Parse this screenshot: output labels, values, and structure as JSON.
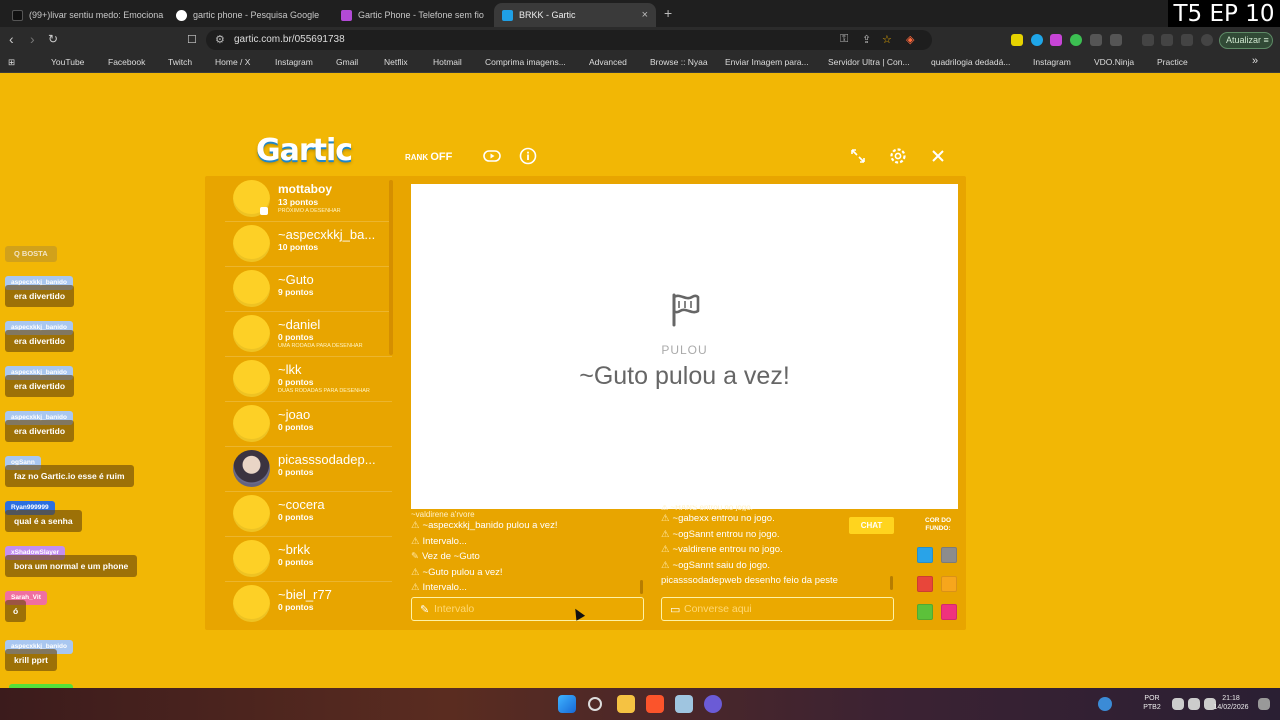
{
  "browser": {
    "tabs": [
      {
        "title": "(99+)livar sentiu medo: Emocionante"
      },
      {
        "title": "gartic phone - Pesquisa Google"
      },
      {
        "title": "Gartic Phone - Telefone sem fio"
      },
      {
        "title": "BRKK - Gartic",
        "active": true
      }
    ],
    "close_glyph": "×",
    "new_tab_glyph": "+",
    "address": "gartic.com.br/055691738",
    "update_label": "Atualizar",
    "bookmarks": [
      {
        "label": "YouTube",
        "color": "#ff0000"
      },
      {
        "label": "Facebook",
        "color": "#1877f2"
      },
      {
        "label": "Twitch",
        "color": "#9146ff"
      },
      {
        "label": "Home / X",
        "color": "#ffffff"
      },
      {
        "label": "Instagram",
        "color": "#e1306c"
      },
      {
        "label": "Gmail",
        "color": "#ea4335"
      },
      {
        "label": "Netflix",
        "color": "#e50914"
      },
      {
        "label": "Hotmail",
        "color": "#bbbbbb"
      },
      {
        "label": "Comprima imagens...",
        "color": "#4a90e2"
      },
      {
        "label": "Advanced",
        "color": "#f5a623"
      },
      {
        "label": "Browse :: Nyaa",
        "color": "#888888"
      },
      {
        "label": "Enviar Imagem para...",
        "color": "#27ae60"
      },
      {
        "label": "Servidor Ultra | Con...",
        "color": "#cccccc"
      },
      {
        "label": "quadrilogia dedadá...",
        "color": "#e91e63"
      },
      {
        "label": "Instagram",
        "color": "#e1306c"
      },
      {
        "label": "VDO.Ninja",
        "color": "#ffffff"
      },
      {
        "label": "Practice",
        "color": "#dddddd"
      }
    ],
    "more_glyph": "»"
  },
  "overlay_badge": "T5 EP 10",
  "game": {
    "logo": "Gartic",
    "rank_label": "RANK",
    "rank_value": "OFF",
    "players": [
      {
        "name": "mottaboy",
        "points": "13 pontos",
        "note": "PRÓXIMO A DESENHAR",
        "bold": true
      },
      {
        "name": "~aspecxkkj_ba...",
        "points": "10 pontos",
        "note": ""
      },
      {
        "name": "~Guto",
        "points": "9 pontos",
        "note": ""
      },
      {
        "name": "~daniel",
        "points": "0 pontos",
        "note": "UMA RODADA PARA DESENHAR"
      },
      {
        "name": "~lkk",
        "points": "0 pontos",
        "note": "DUAS RODADAS PARA DESENHAR"
      },
      {
        "name": "~joao",
        "points": "0 pontos",
        "note": ""
      },
      {
        "name": "picasssodadep...",
        "points": "0 pontos",
        "note": "",
        "photo": true
      },
      {
        "name": "~cocera",
        "points": "0 pontos",
        "note": ""
      },
      {
        "name": "~brkk",
        "points": "0 pontos",
        "note": ""
      },
      {
        "name": "~biel_r77",
        "points": "0 pontos",
        "note": ""
      }
    ],
    "canvas": {
      "label": "PULOU",
      "message": "~Guto pulou a vez!"
    },
    "answers_log": [
      {
        "icon": "⚠",
        "text": "~aspecxkkj_banido pulou a vez!"
      },
      {
        "icon": "⚠",
        "text": "Intervalo..."
      },
      {
        "icon": "✎",
        "text": "Vez de ~Guto"
      },
      {
        "icon": "⚠",
        "text": "~Guto pulou a vez!"
      },
      {
        "icon": "⚠",
        "text": "Intervalo..."
      }
    ],
    "chat_log": [
      {
        "icon": "⚠",
        "text": "~gabexx entrou no jogo."
      },
      {
        "icon": "⚠",
        "text": "~ogSannt entrou no jogo."
      },
      {
        "icon": "⚠",
        "text": "~valdirene entrou no jogo."
      },
      {
        "icon": "⚠",
        "text": "~ogSannt saiu do jogo."
      },
      {
        "icon": "",
        "text": "picasssodadepweb desenho feio da peste"
      }
    ],
    "answer_input_placeholder": "Intervalo",
    "chat_input_placeholder": "Converse aqui",
    "chat_tag": "CHAT",
    "background_label": "COR DO FUNDO:",
    "background_colors": [
      "#29a3e8",
      "#8c8c8c",
      "#e8463a",
      "#f7a61c",
      "#5cc13a",
      "#f0327d"
    ]
  },
  "overlay_chat": [
    {
      "user": "",
      "msg": "Q BOSTA",
      "user_color": "#d8c3a0"
    },
    {
      "user": "aspecxkkj_banido",
      "msg": "era divertido",
      "user_color": "#a9c7f0"
    },
    {
      "user": "aspecxkkj_banido",
      "msg": "era divertido",
      "user_color": "#a9c7f0"
    },
    {
      "user": "aspecxkkj_banido",
      "msg": "era divertido",
      "user_color": "#a9c7f0"
    },
    {
      "user": "aspecxkkj_banido",
      "msg": "era divertido",
      "user_color": "#a9c7f0"
    },
    {
      "user": "ogSann",
      "msg": "faz no Gartic.io esse é ruim",
      "user_color": "#a9c7f0"
    },
    {
      "user": "Ryan999999",
      "msg": "qual é a senha",
      "user_color": "#2c6fe0"
    },
    {
      "user": "xShadowSlayer",
      "msg": "bora um normal e um phone",
      "user_color": "#c38ff0"
    },
    {
      "user": "Sarah_Vit",
      "msg": "ó",
      "user_color": "#f06fa0"
    },
    {
      "user": "aspecxkkj_banido",
      "msg": "krill pprt",
      "user_color": "#a9c7f0"
    }
  ],
  "taskbar": {
    "tray_lang": "POR\nPTB2",
    "time": "21:18",
    "date": "14/02/2026"
  }
}
